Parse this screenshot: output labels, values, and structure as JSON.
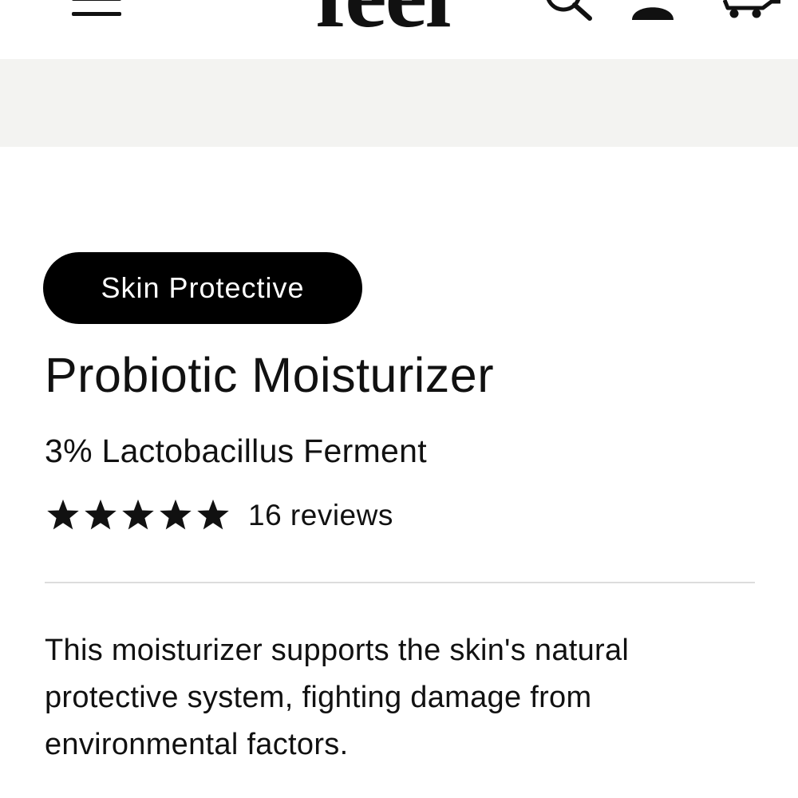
{
  "header": {
    "logo_text": "feel",
    "menu_icon": "hamburger-menu-icon",
    "search_icon": "search-icon",
    "account_icon": "user-icon",
    "cart_icon": "cart-icon"
  },
  "banner": {
    "color": "#f3f3f1"
  },
  "product": {
    "category": "Skin Protective",
    "title": "Probiotic Moisturizer",
    "subtitle": "3% Lactobacillus Ferment",
    "rating": {
      "stars": 5,
      "max_stars": 5,
      "reviews_label": "16 reviews"
    },
    "description": "This moisturizer supports the skin's natural protective system, fighting damage from environmental factors."
  },
  "colors": {
    "pill_background": "#000000",
    "pill_text": "#ffffff",
    "text": "#111111",
    "divider": "#dcdcdc"
  }
}
